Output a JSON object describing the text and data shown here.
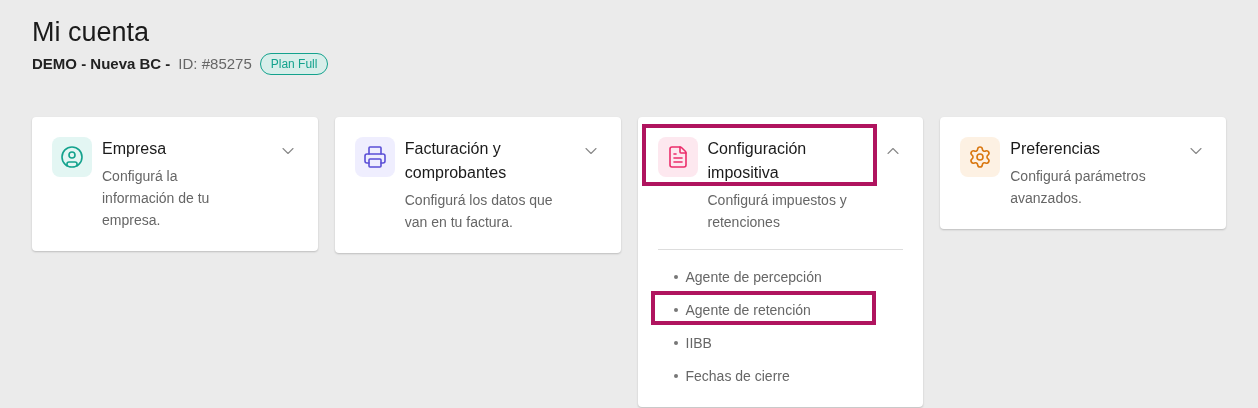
{
  "page_title": "Mi cuenta",
  "account": {
    "name": "DEMO - Nueva BC -",
    "id": "ID: #85275",
    "plan": "Plan Full"
  },
  "cards": [
    {
      "kind": "user",
      "title": "Empresa",
      "description": "Configurá la información de tu empresa.",
      "expanded": false,
      "highlighted": false
    },
    {
      "kind": "printer",
      "title": "Facturación y comprobantes",
      "description": "Configurá los datos que van en tu factura.",
      "expanded": false,
      "highlighted": false
    },
    {
      "kind": "tax",
      "title": "Configuración impositiva",
      "description": "Configurá impuestos y retenciones",
      "expanded": true,
      "highlighted": true,
      "items": [
        {
          "label": "Agente de percepción",
          "highlighted": false
        },
        {
          "label": "Agente de retención",
          "highlighted": true
        },
        {
          "label": "IIBB",
          "highlighted": false
        },
        {
          "label": "Fechas de cierre",
          "highlighted": false
        }
      ]
    },
    {
      "kind": "gear",
      "title": "Preferencias",
      "description": "Configurá parámetros avanzados.",
      "expanded": false,
      "highlighted": false
    }
  ]
}
